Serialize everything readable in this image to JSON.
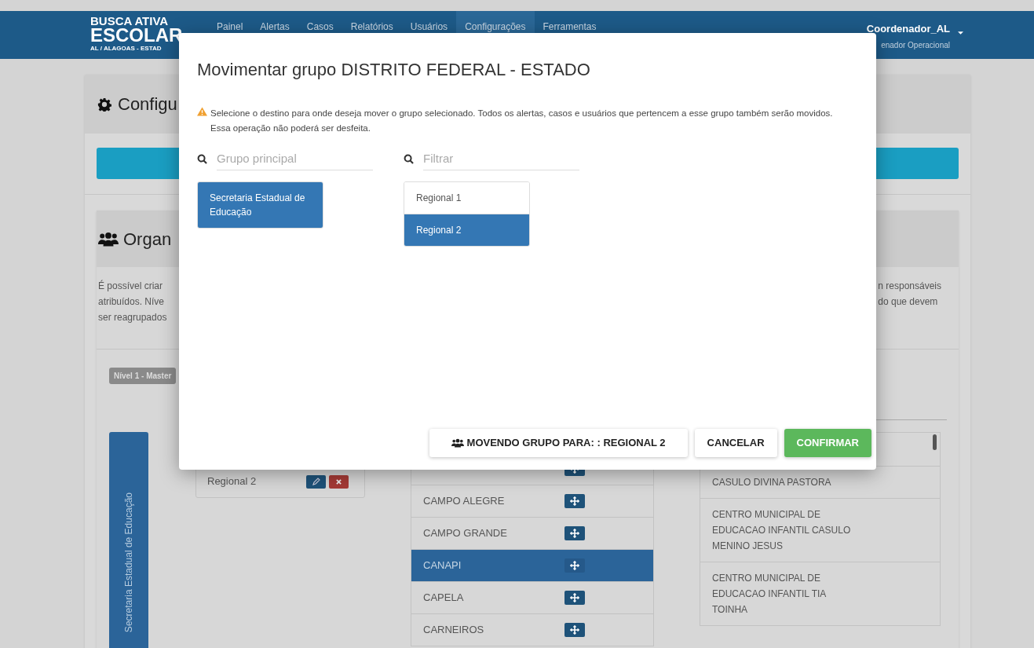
{
  "navbar": {
    "logo": {
      "line1": "BUSCA ATIVA",
      "line2": "ESCOLAR",
      "subtitle": "AL / ALAGOAS - ESTAD"
    },
    "nav_items": [
      {
        "label": "Painel",
        "selected": false
      },
      {
        "label": "Alertas",
        "selected": false
      },
      {
        "label": "Casos",
        "selected": false
      },
      {
        "label": "Relatórios",
        "selected": false
      },
      {
        "label": "Usuários",
        "selected": false
      },
      {
        "label": "Configurações",
        "selected": true
      },
      {
        "label": "Ferramentas",
        "selected": false
      }
    ],
    "user": {
      "name": "Coordenador_AL",
      "role": "enador Operacional"
    }
  },
  "page": {
    "config_title": "Configu",
    "org_title": "Organ",
    "description_left": [
      "É possível criar",
      "atribuídos. Níve",
      "ser reagrupados"
    ],
    "description_right": [
      "n responsáveis",
      "do que devem"
    ],
    "level_badge": "Nível 1 - Master",
    "root_group": "Secretaria Estadual de Educação",
    "groups": [
      {
        "label": "Regional 2"
      }
    ],
    "municipalities": [
      {
        "name": "CAMPO ALEGRE",
        "selected": false
      },
      {
        "name": "CAMPO GRANDE",
        "selected": false
      },
      {
        "name": "CANAPI",
        "selected": true
      },
      {
        "name": "CAPELA",
        "selected": false
      },
      {
        "name": "CARNEIROS",
        "selected": false
      }
    ],
    "schools": [
      {
        "name": "CASULO DIVINA PASTORA"
      },
      {
        "name": "CENTRO MUNICIPAL DE EDUCACAO INFANTIL CASULO MENINO JESUS"
      },
      {
        "name": "CENTRO MUNICIPAL DE EDUCACAO INFANTIL TIA TOINHA"
      }
    ]
  },
  "modal": {
    "title": "Movimentar grupo DISTRITO FEDERAL - ESTADO",
    "warning": "Selecione o destino para onde deseja mover o grupo selecionado. Todos os alertas, casos e usuários que pertencem a esse grupo também serão movidos. Essa operação não poderá ser desfeita.",
    "parent_search": {
      "placeholder": "Grupo principal"
    },
    "parents": [
      {
        "label": "Secretaria Estadual de Educação",
        "selected": true
      }
    ],
    "child_search": {
      "placeholder": "Filtrar"
    },
    "children": [
      {
        "label": "Regional 1",
        "selected": false
      },
      {
        "label": "Regional 2",
        "selected": true
      }
    ],
    "moving_button": "MOVENDO GRUPO PARA: : REGIONAL 2",
    "cancel": "CANCELAR",
    "confirm": "CONFIRMAR"
  }
}
